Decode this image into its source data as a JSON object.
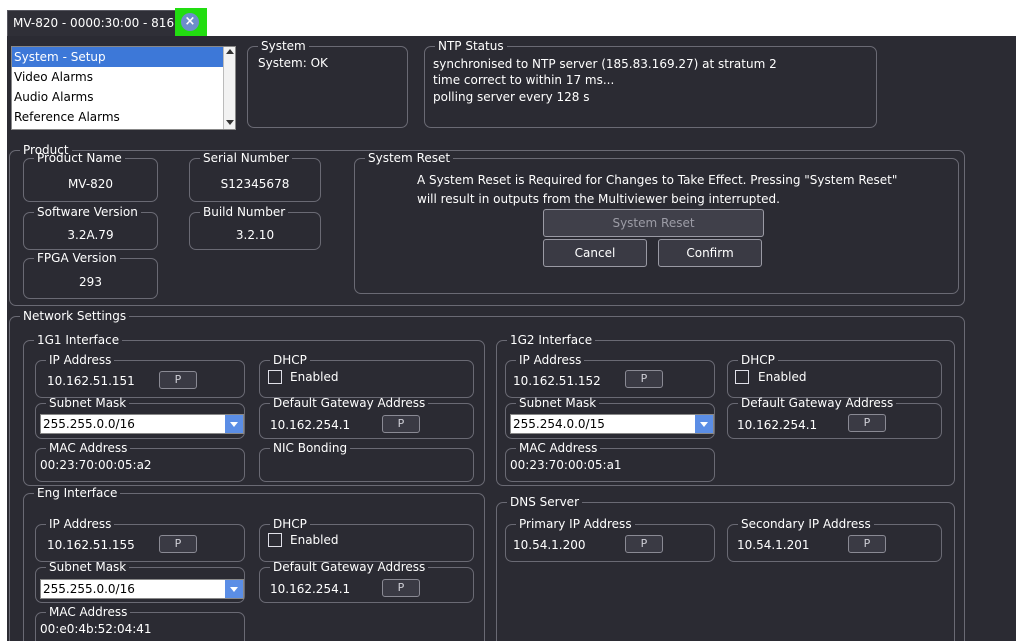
{
  "tab": {
    "title": "MV-820 - 0000:30:00 - 816"
  },
  "nav_list": [
    "System - Setup",
    "Video Alarms",
    "Audio Alarms",
    "Reference Alarms"
  ],
  "system": {
    "legend": "System",
    "status": "System: OK"
  },
  "ntp": {
    "legend": "NTP Status",
    "lines": [
      "synchronised to NTP server (185.83.169.27) at stratum 2",
      "time correct to within 17 ms...",
      "polling server every 128 s"
    ]
  },
  "product": {
    "legend": "Product",
    "name_label": "Product Name",
    "name": "MV-820",
    "serial_label": "Serial Number",
    "serial": "S12345678",
    "sw_label": "Software Version",
    "sw": "3.2A.79",
    "build_label": "Build Number",
    "build": "3.2.10",
    "fpga_label": "FPGA Version",
    "fpga": "293"
  },
  "reset": {
    "legend": "System Reset",
    "msg1": "A System Reset is Required for Changes to Take Effect. Pressing \"System Reset\"",
    "msg2": "will result in outputs from the Multiviewer being interrupted.",
    "reset_btn": "System Reset",
    "cancel_btn": "Cancel",
    "confirm_btn": "Confirm"
  },
  "network": {
    "legend": "Network Settings",
    "p_label": "P",
    "g1": {
      "legend": "1G1 Interface",
      "ip_label": "IP Address",
      "ip": "10.162.51.151",
      "dhcp_label": "DHCP",
      "enabled": "Enabled",
      "subnet_label": "Subnet Mask",
      "subnet": "255.255.0.0/16",
      "gateway_label": "Default Gateway Address",
      "gateway": "10.162.254.1",
      "mac_label": "MAC Address",
      "mac": "00:23:70:00:05:a2",
      "nic_label": "NIC Bonding"
    },
    "g2": {
      "legend": "1G2 Interface",
      "ip_label": "IP Address",
      "ip": "10.162.51.152",
      "dhcp_label": "DHCP",
      "enabled": "Enabled",
      "subnet_label": "Subnet Mask",
      "subnet": "255.254.0.0/15",
      "gateway_label": "Default Gateway Address",
      "gateway": "10.162.254.1",
      "mac_label": "MAC Address",
      "mac": "00:23:70:00:05:a1"
    },
    "eng": {
      "legend": "Eng Interface",
      "ip_label": "IP Address",
      "ip": "10.162.51.155",
      "dhcp_label": "DHCP",
      "enabled": "Enabled",
      "subnet_label": "Subnet Mask",
      "subnet": "255.255.0.0/16",
      "gateway_label": "Default Gateway Address",
      "gateway": "10.162.254.1",
      "mac_label": "MAC Address",
      "mac": "00:e0:4b:52:04:41"
    },
    "dns": {
      "legend": "DNS Server",
      "primary_label": "Primary IP Address",
      "primary": "10.54.1.200",
      "secondary_label": "Secondary IP Address",
      "secondary": "10.54.1.201"
    }
  }
}
